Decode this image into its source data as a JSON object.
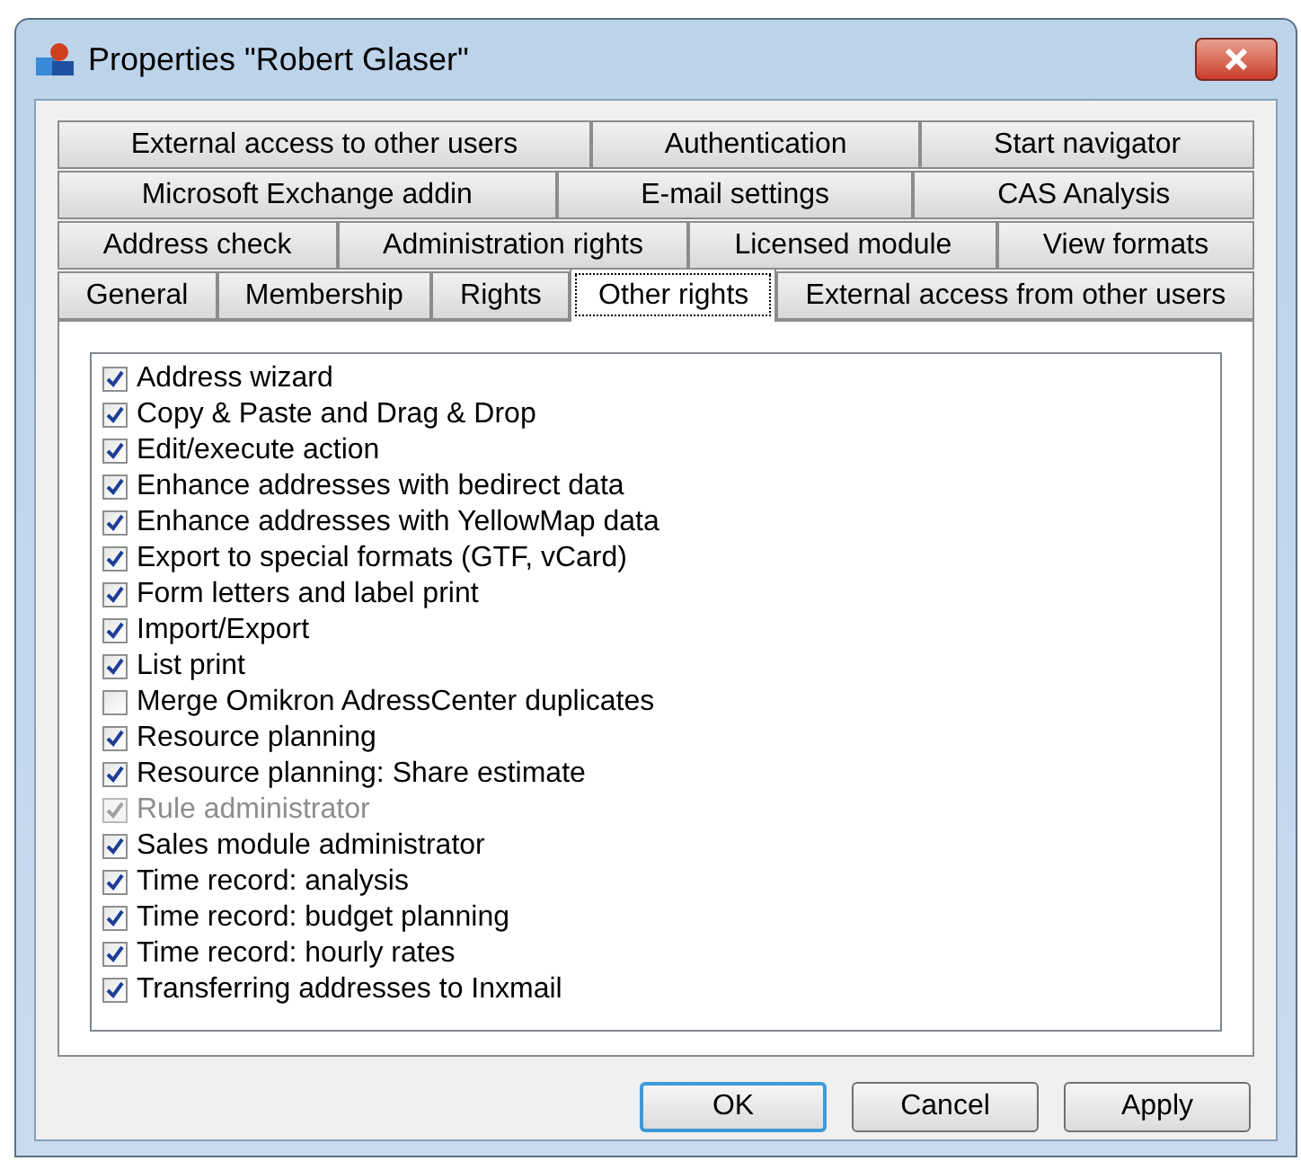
{
  "window": {
    "title": "Properties \"Robert Glaser\""
  },
  "tab_rows": [
    [
      {
        "label": "External access to other users",
        "selected": false
      },
      {
        "label": "Authentication",
        "selected": false
      },
      {
        "label": "Start navigator",
        "selected": false
      }
    ],
    [
      {
        "label": "Microsoft Exchange addin",
        "selected": false
      },
      {
        "label": "E-mail settings",
        "selected": false
      },
      {
        "label": "CAS Analysis",
        "selected": false
      }
    ],
    [
      {
        "label": "Address check",
        "selected": false
      },
      {
        "label": "Administration rights",
        "selected": false
      },
      {
        "label": "Licensed module",
        "selected": false
      },
      {
        "label": "View formats",
        "selected": false
      }
    ],
    [
      {
        "label": "General",
        "selected": false
      },
      {
        "label": "Membership",
        "selected": false
      },
      {
        "label": "Rights",
        "selected": false
      },
      {
        "label": "Other rights",
        "selected": true
      },
      {
        "label": "External access from other users",
        "selected": false
      }
    ]
  ],
  "rights": [
    {
      "label": "Address wizard",
      "checked": true,
      "disabled": false
    },
    {
      "label": "Copy & Paste and Drag & Drop",
      "checked": true,
      "disabled": false
    },
    {
      "label": "Edit/execute action",
      "checked": true,
      "disabled": false
    },
    {
      "label": "Enhance addresses with bedirect data",
      "checked": true,
      "disabled": false
    },
    {
      "label": "Enhance addresses with YellowMap data",
      "checked": true,
      "disabled": false
    },
    {
      "label": "Export to special formats (GTF, vCard)",
      "checked": true,
      "disabled": false
    },
    {
      "label": "Form letters and label print",
      "checked": true,
      "disabled": false
    },
    {
      "label": "Import/Export",
      "checked": true,
      "disabled": false
    },
    {
      "label": "List print",
      "checked": true,
      "disabled": false
    },
    {
      "label": "Merge Omikron AdressCenter duplicates",
      "checked": false,
      "disabled": false
    },
    {
      "label": "Resource planning",
      "checked": true,
      "disabled": false
    },
    {
      "label": "Resource planning: Share estimate",
      "checked": true,
      "disabled": false
    },
    {
      "label": "Rule administrator",
      "checked": true,
      "disabled": true
    },
    {
      "label": "Sales module administrator",
      "checked": true,
      "disabled": false
    },
    {
      "label": "Time record: analysis",
      "checked": true,
      "disabled": false
    },
    {
      "label": "Time record: budget planning",
      "checked": true,
      "disabled": false
    },
    {
      "label": "Time record: hourly rates",
      "checked": true,
      "disabled": false
    },
    {
      "label": "Transferring addresses to Inxmail",
      "checked": true,
      "disabled": false
    }
  ],
  "buttons": [
    {
      "label": "OK",
      "default": true
    },
    {
      "label": "Cancel",
      "default": false
    },
    {
      "label": "Apply",
      "default": false
    }
  ]
}
